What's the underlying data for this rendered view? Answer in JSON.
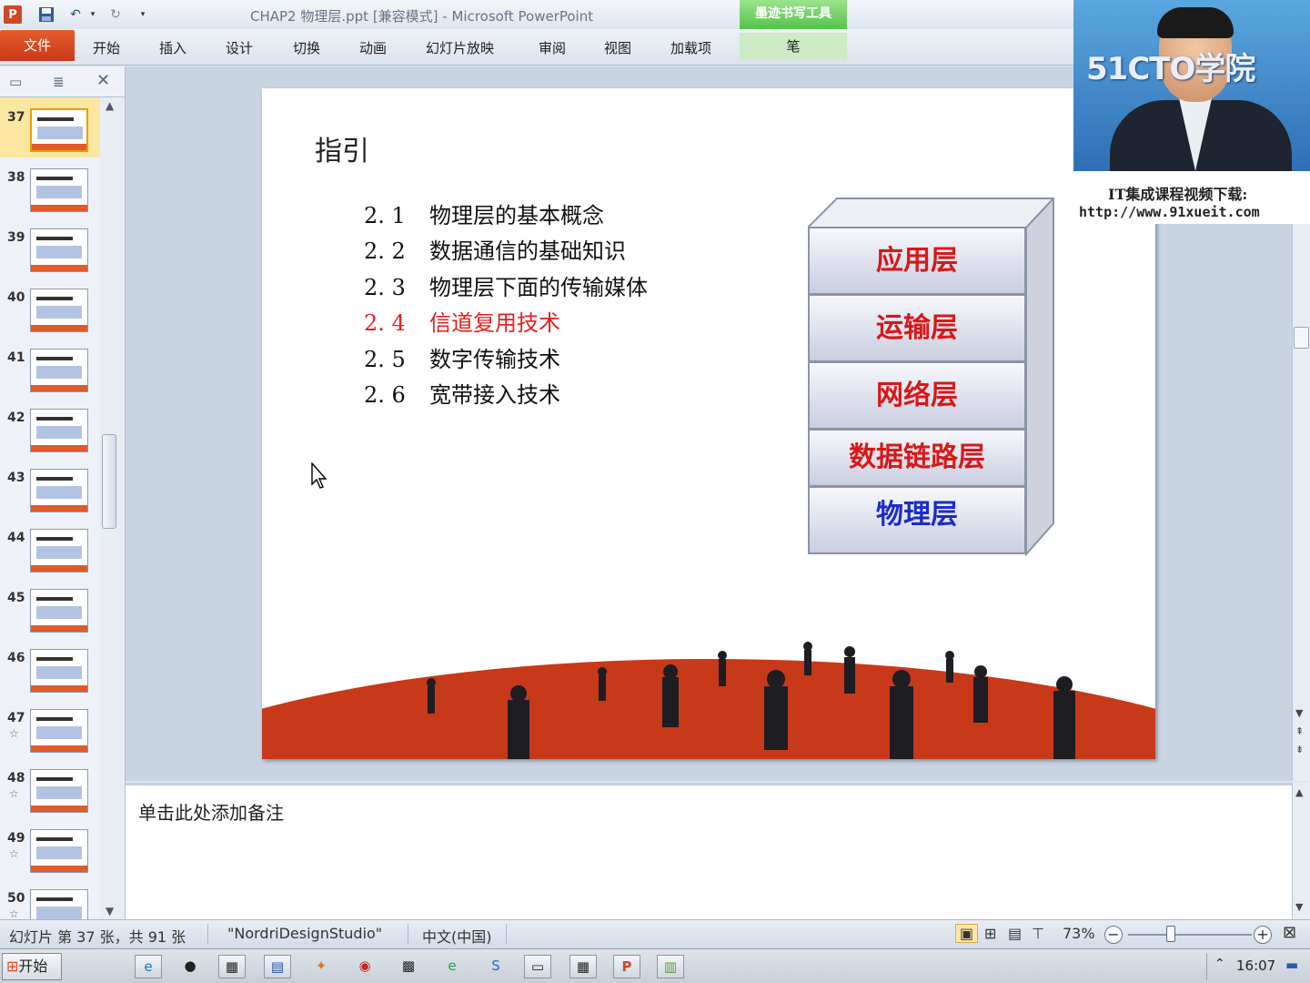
{
  "window": {
    "title": "CHAP2 物理层.ppt [兼容模式]  -  Microsoft PowerPoint",
    "contextual_tab": "墨迹书写工具"
  },
  "ribbon": {
    "tabs": [
      "文件",
      "开始",
      "插入",
      "设计",
      "切换",
      "动画",
      "幻灯片放映",
      "审阅",
      "视图",
      "加载项",
      "笔"
    ]
  },
  "thumbnails": [
    {
      "num": "37",
      "star": ""
    },
    {
      "num": "38",
      "star": ""
    },
    {
      "num": "39",
      "star": ""
    },
    {
      "num": "40",
      "star": ""
    },
    {
      "num": "41",
      "star": ""
    },
    {
      "num": "42",
      "star": ""
    },
    {
      "num": "43",
      "star": ""
    },
    {
      "num": "44",
      "star": ""
    },
    {
      "num": "45",
      "star": ""
    },
    {
      "num": "46",
      "star": ""
    },
    {
      "num": "47",
      "star": "☆"
    },
    {
      "num": "48",
      "star": "☆"
    },
    {
      "num": "49",
      "star": "☆"
    },
    {
      "num": "50",
      "star": "☆"
    }
  ],
  "slide": {
    "title": "指引",
    "toc": [
      {
        "num": "2. 1",
        "text": "物理层的基本概念"
      },
      {
        "num": "2. 2",
        "text": "数据通信的基础知识"
      },
      {
        "num": "2. 3",
        "text": "物理层下面的传输媒体"
      },
      {
        "num": "2. 4",
        "text": "信道复用技术"
      },
      {
        "num": "2. 5",
        "text": "数字传输技术"
      },
      {
        "num": "2. 6",
        "text": "宽带接入技术"
      }
    ],
    "layers": [
      "应用层",
      "运输层",
      "网络层",
      "数据链路层",
      "物理层"
    ]
  },
  "notes": {
    "placeholder": "单击此处添加备注"
  },
  "status": {
    "slide_info": "幻灯片 第 37 张，共 91 张",
    "theme": "\"NordriDesignStudio\"",
    "language": "中文(中国)",
    "zoom": "73%",
    "zoom_value": 0.73
  },
  "taskbar": {
    "start": "开始",
    "clock": "16:07"
  },
  "webcam": {
    "logo": "51CTO学院",
    "caption_line1": "IT集成课程视频下载:",
    "caption_line2": "http://www.91xueit.com"
  },
  "colors": {
    "file_tab": "#d24726",
    "highlight_red": "#e81e1e",
    "layer_blue": "#1c2bc8",
    "ink_tab_green": "#55c14a"
  }
}
